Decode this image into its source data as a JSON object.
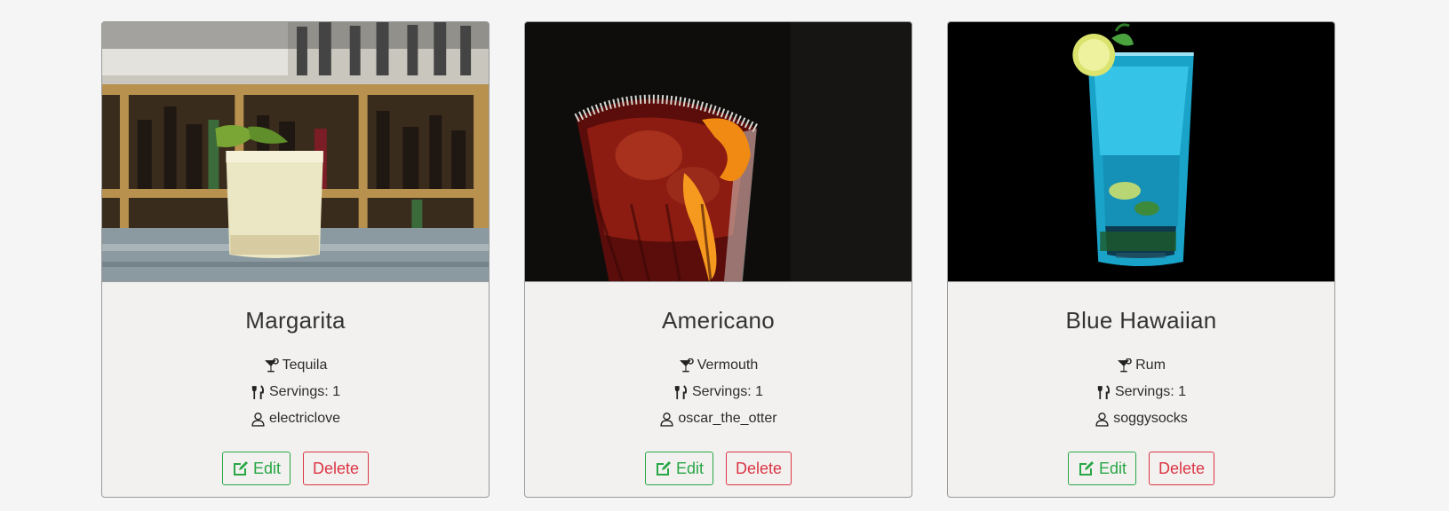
{
  "cards": [
    {
      "title": "Margarita",
      "spirit": "Tequila",
      "servings": "Servings: 1",
      "author": "electriclove",
      "edit_label": "Edit",
      "delete_label": "Delete",
      "photo_theme": "bar-shelf"
    },
    {
      "title": "Americano",
      "spirit": "Vermouth",
      "servings": "Servings: 1",
      "author": "oscar_the_otter",
      "edit_label": "Edit",
      "delete_label": "Delete",
      "photo_theme": "dark-orange"
    },
    {
      "title": "Blue Hawaiian",
      "spirit": "Rum",
      "servings": "Servings: 1",
      "author": "soggysocks",
      "edit_label": "Edit",
      "delete_label": "Delete",
      "photo_theme": "dark-blue"
    }
  ],
  "colors": {
    "edit": "#28a745",
    "delete": "#dc3545",
    "card_bg": "#f2f1ef",
    "page_bg": "#f5f5f5"
  },
  "icons": {
    "spirit": "cocktail-icon",
    "servings": "utensils-icon",
    "author": "user-icon",
    "edit": "edit-icon"
  }
}
